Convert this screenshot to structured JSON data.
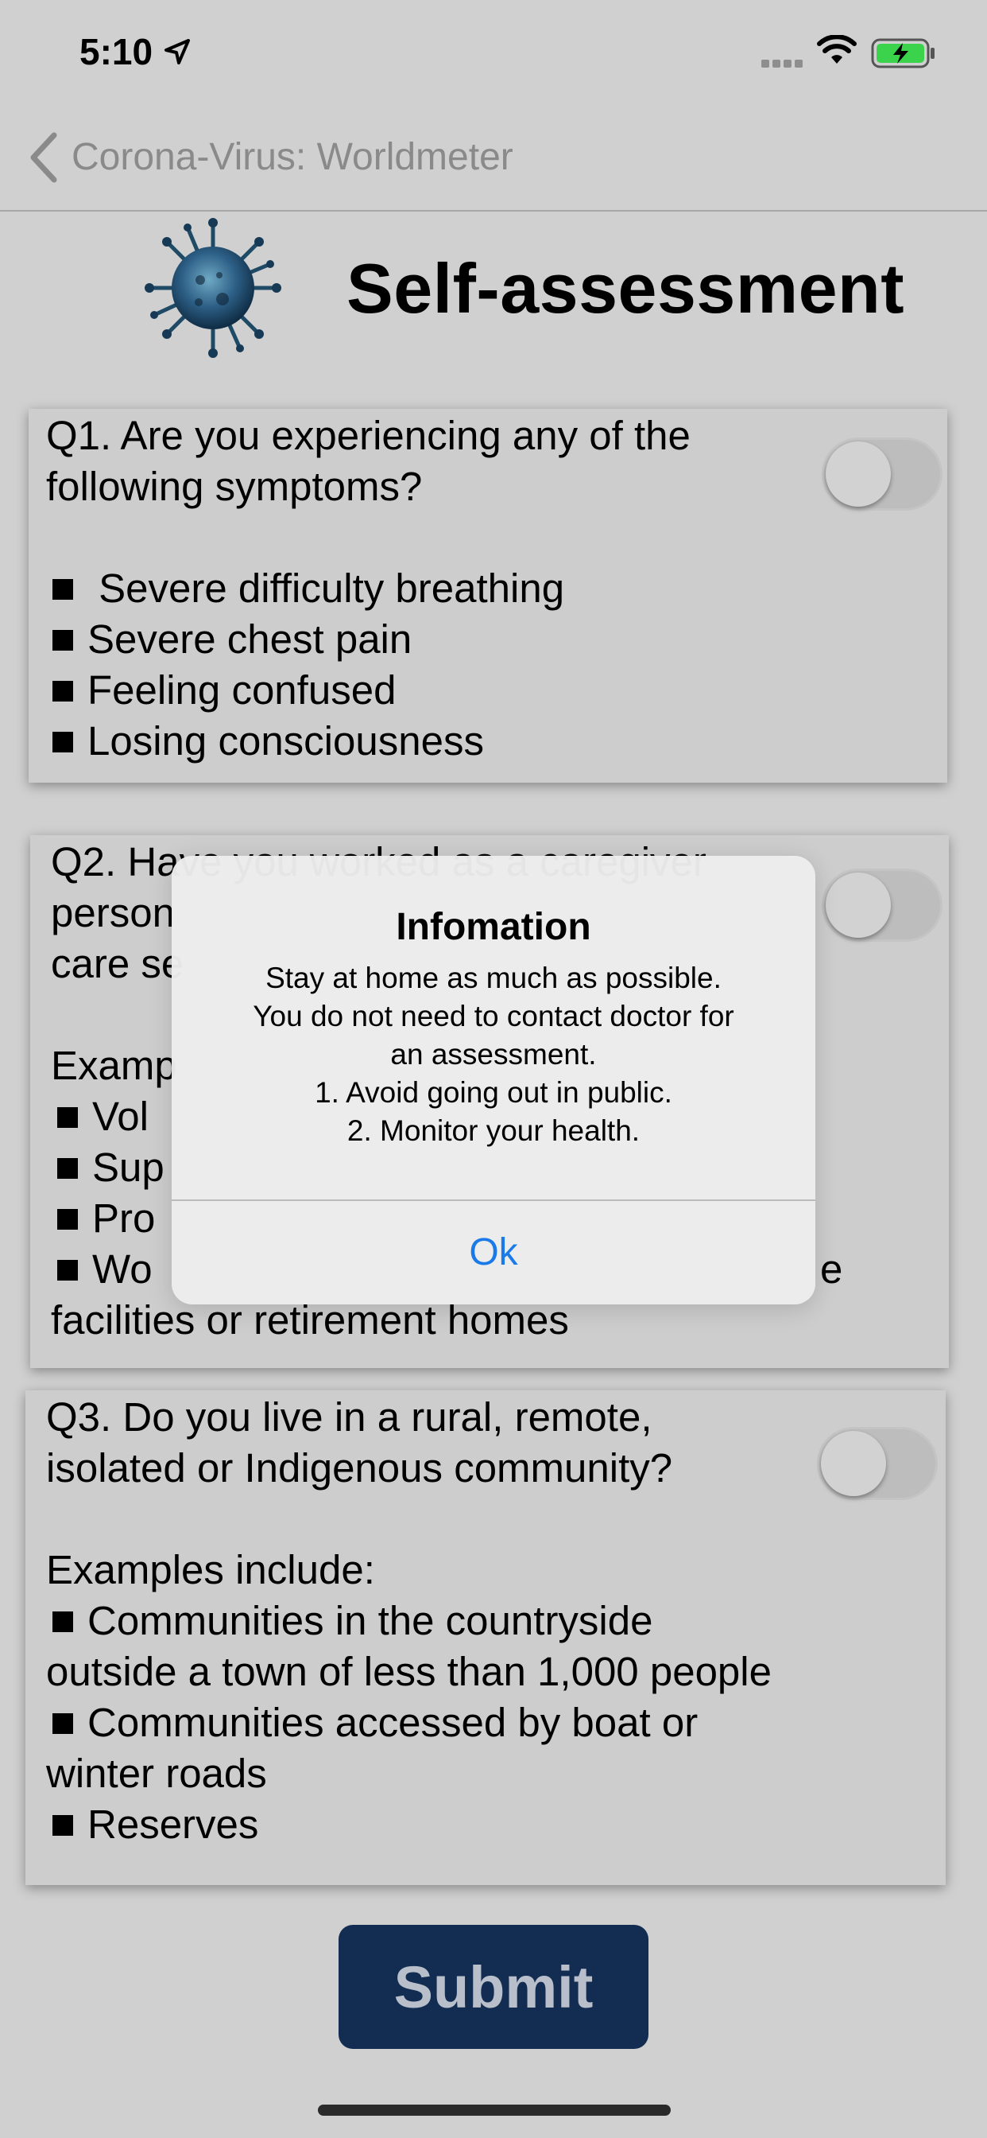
{
  "status_bar": {
    "time": "5:10",
    "icons": [
      "location-arrow-icon",
      "cellular-signal-icon",
      "wifi-icon",
      "battery-charging-icon"
    ],
    "battery_color": "#3bd34b"
  },
  "nav": {
    "back_label": "Corona-Virus: Worldmeter"
  },
  "header": {
    "title": "Self-assessment",
    "image": "virus-illustration"
  },
  "questions": [
    {
      "lines": [
        "Q1.  Are you experiencing any of the",
        "following symptoms?"
      ],
      "items": [
        " Severe difficulty breathing",
        "Severe chest pain",
        "Feeling confused",
        "Losing consciousness"
      ],
      "toggle_on": false
    },
    {
      "visible_lines": [
        "Q2.  Have you worked as a caregiver",
        "person",
        "care se"
      ],
      "examples_label": "Examp",
      "items": [
        "Vol",
        "Sup",
        "Pro",
        "Wo"
      ],
      "item_tail": "e",
      "last_line": "facilities or retirement homes",
      "toggle_on": false
    },
    {
      "lines": [
        "Q3.  Do you live in a rural, remote,",
        "isolated or Indigenous community?"
      ],
      "examples_label": "Examples include:",
      "items": [
        [
          "Communities in the countryside",
          "outside a town of less than 1,000 people"
        ],
        [
          "Communities accessed by boat or",
          "winter roads"
        ],
        [
          "Reserves"
        ]
      ],
      "toggle_on": false
    }
  ],
  "submit_label": "Submit",
  "alert": {
    "title": "Infomation",
    "body": [
      "Stay at home as much as possible.",
      "You do not need to contact doctor for",
      "an assessment.",
      "1. Avoid going out in public.",
      "2. Monitor your health."
    ],
    "button": "Ok",
    "button_color": "#1a7ae8"
  }
}
